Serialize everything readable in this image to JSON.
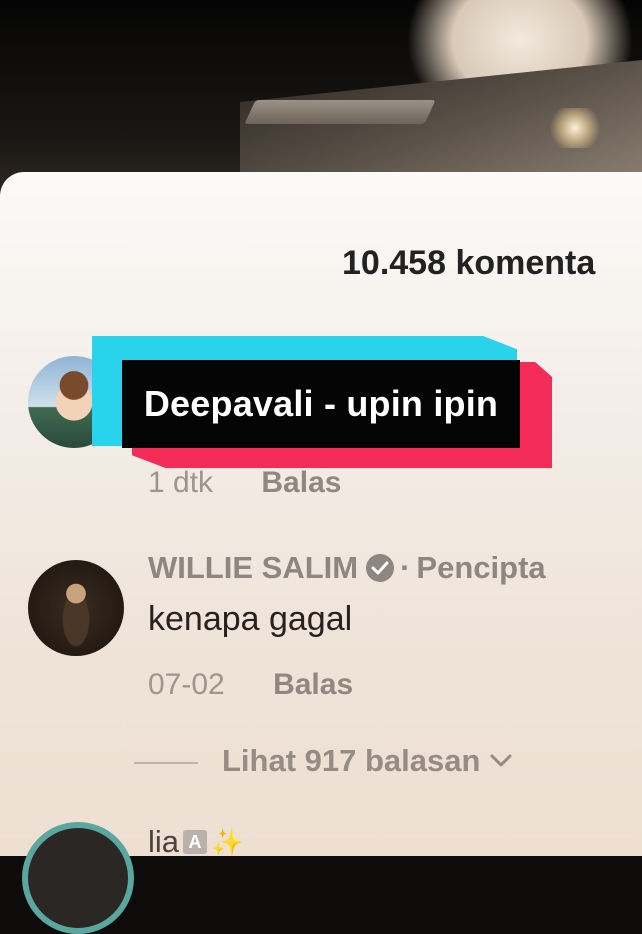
{
  "banner": {
    "title": "Deepavali - upin ipin"
  },
  "comments_header": {
    "count_label": "10.458 komenta"
  },
  "comment1": {
    "time": "1 dtk",
    "reply_label": "Balas"
  },
  "comment2": {
    "username": "WILLIE SALIM",
    "separator": "·",
    "creator_label": "Pencipta",
    "text": "kenapa gagal",
    "date": "07-02",
    "reply_label": "Balas",
    "view_replies": "Lihat 917 balasan"
  },
  "comment3": {
    "username": "lia",
    "badge": "A",
    "sparkle": "✨"
  },
  "icons": {
    "verified": "verified-check-icon",
    "chevron": "chevron-down-icon"
  },
  "colors": {
    "banner_cyan": "#29d3ec",
    "banner_red": "#f42d58",
    "banner_black": "#050505"
  }
}
